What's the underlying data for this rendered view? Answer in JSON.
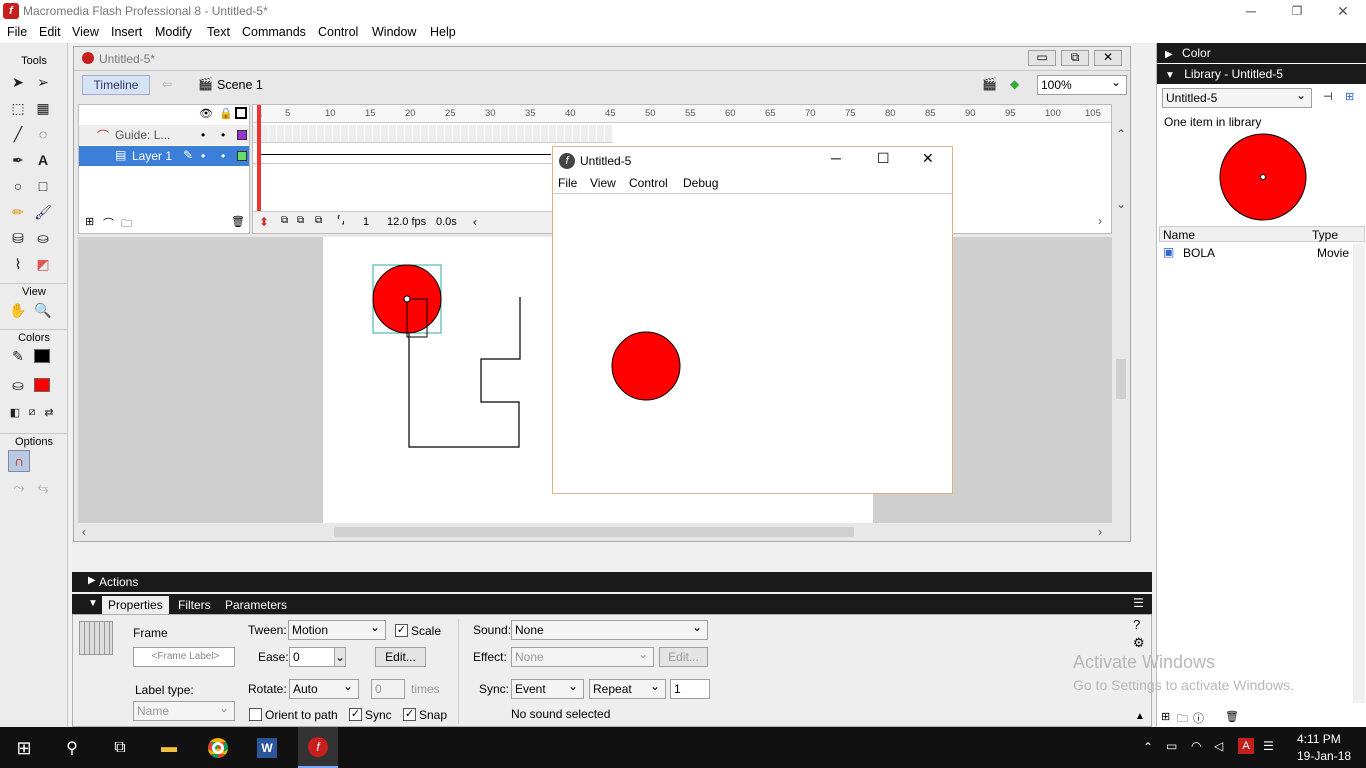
{
  "app": {
    "title": "Macromedia Flash Professional 8 - Untitled-5*",
    "logo_letter": "f",
    "window_controls": [
      "minimize-icon",
      "restore-icon",
      "close-icon"
    ]
  },
  "menu": [
    "File",
    "Edit",
    "View",
    "Insert",
    "Modify",
    "Text",
    "Commands",
    "Control",
    "Window",
    "Help"
  ],
  "tools": {
    "header": "Tools",
    "view_header": "View",
    "colors_header": "Colors",
    "options_header": "Options"
  },
  "document": {
    "tab_title": "Untitled-5*",
    "timeline_button": "Timeline",
    "scene_label": "Scene 1",
    "zoom": "100%",
    "frame_ruler": [
      "1",
      "5",
      "10",
      "15",
      "20",
      "25",
      "30",
      "35",
      "40",
      "45",
      "50",
      "55",
      "60",
      "65",
      "70",
      "75",
      "80",
      "85",
      "90",
      "95",
      "100",
      "105"
    ],
    "layers": [
      {
        "name": "Guide: L...",
        "type": "guide"
      },
      {
        "name": "Layer 1",
        "type": "normal",
        "selected": true
      }
    ],
    "status": {
      "frame": "1",
      "fps": "12.0 fps",
      "time": "0.0s"
    }
  },
  "player": {
    "title": "Untitled-5",
    "menu": [
      "File",
      "View",
      "Control",
      "Debug"
    ]
  },
  "actions_panel": {
    "label": "Actions"
  },
  "properties": {
    "tabs": [
      "Properties",
      "Filters",
      "Parameters"
    ],
    "frame_label": "Frame",
    "frame_label_placeholder": "<Frame Label>",
    "label_type_label": "Label type:",
    "label_type_value": "Name",
    "tween_label": "Tween:",
    "tween_value": "Motion",
    "scale_label": "Scale",
    "ease_label": "Ease:",
    "ease_value": "0",
    "edit_button": "Edit...",
    "rotate_label": "Rotate:",
    "rotate_value": "Auto",
    "times_value": "0",
    "times_label": "times",
    "orient_label": "Orient to path",
    "sync_check_label": "Sync",
    "snap_label": "Snap",
    "sound_label": "Sound:",
    "sound_value": "None",
    "effect_label": "Effect:",
    "effect_value": "None",
    "effect_edit": "Edit...",
    "sync_label": "Sync:",
    "sync_value": "Event",
    "repeat_value": "Repeat",
    "repeat_count": "1",
    "sound_status": "No sound selected"
  },
  "right_panel": {
    "color_header": "Color",
    "library_header": "Library - Untitled-5",
    "library_select": "Untitled-5",
    "item_count": "One item in library",
    "col_name": "Name",
    "col_type": "Type",
    "items": [
      {
        "name": "BOLA",
        "type": "Movie"
      }
    ]
  },
  "watermark": {
    "line1": "Activate Windows",
    "line2": "Go to Settings to activate Windows."
  },
  "taskbar": {
    "time": "4:11 PM",
    "date": "19-Jan-18"
  },
  "colors": {
    "ball": "#ff0000",
    "accent": "#2b6fd6",
    "selected_layer": "#3c7fd8"
  }
}
